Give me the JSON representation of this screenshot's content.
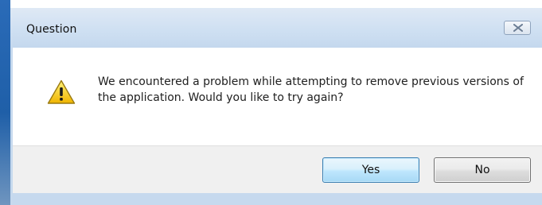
{
  "dialog": {
    "title": "Question",
    "message": "We encountered a problem while attempting to remove previous versions of the application. Would you like to try again?",
    "icon": "warning-icon",
    "buttons": {
      "yes_label": "Yes",
      "no_label": "No"
    },
    "close_icon": "close-icon"
  },
  "colors": {
    "frame": "#c6d9ee",
    "content_background": "#ffffff",
    "button_area": "#f0f0f0",
    "default_button_border": "#3c7fb1",
    "warning_yellow": "#f5c518"
  }
}
